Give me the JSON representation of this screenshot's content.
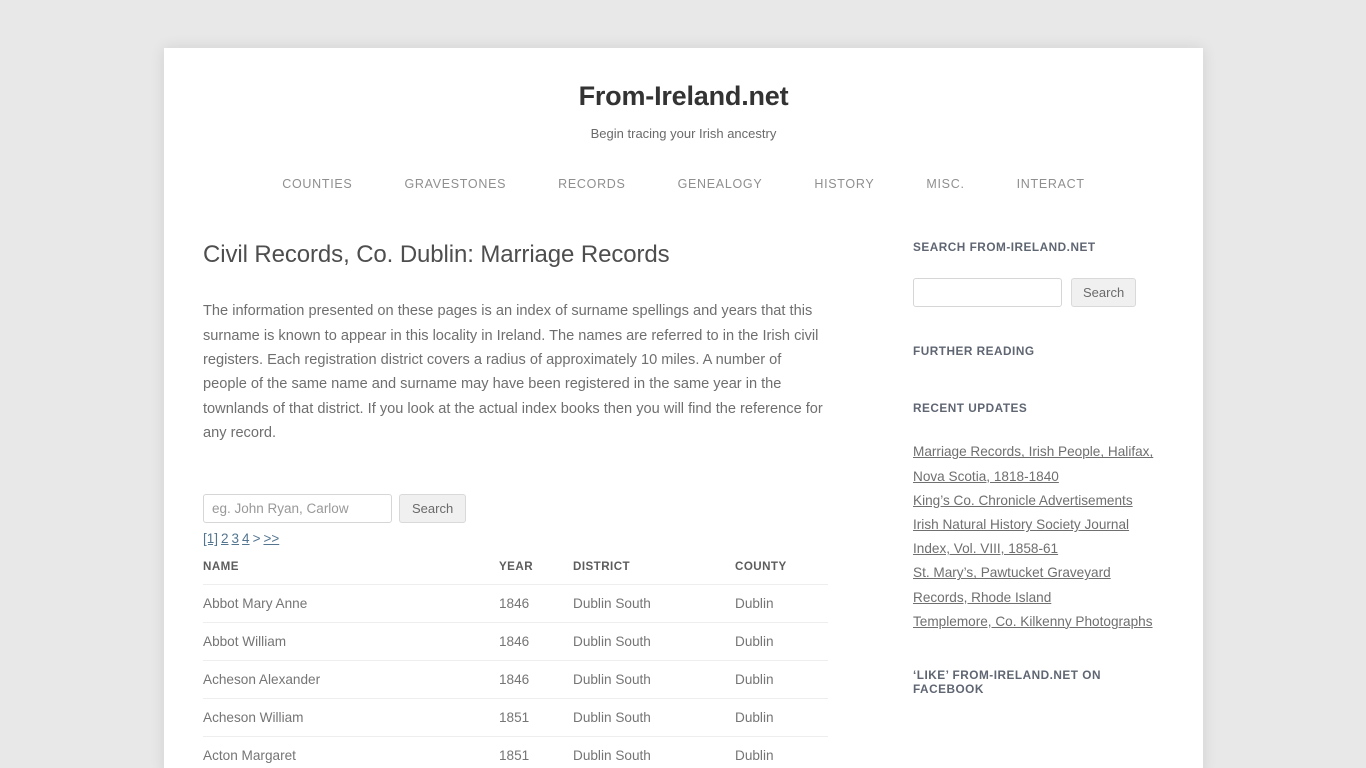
{
  "site": {
    "title": "From-Ireland.net",
    "description": "Begin tracing your Irish ancestry",
    "nav": [
      {
        "label": "COUNTIES"
      },
      {
        "label": "GRAVESTONES"
      },
      {
        "label": "RECORDS"
      },
      {
        "label": "GENEALOGY"
      },
      {
        "label": "HISTORY"
      },
      {
        "label": "MISC."
      },
      {
        "label": "INTERACT"
      }
    ]
  },
  "main": {
    "title": "Civil Records, Co. Dublin: Marriage Records",
    "intro": "The information presented on these pages is an index of surname spellings and years that this surname is known to appear in this locality in Ireland. The names are referred to in the Irish civil registers. Each registration district covers a radius of approximately 10 miles. A number of people of the same name and surname may have been registered in the same year in the townlands of that district. If you look at the actual index books then you will find the reference for any record.",
    "search": {
      "value": "",
      "placeholder": "eg. John Ryan, Carlow",
      "button_label": "Search"
    },
    "pagination": {
      "current": "[1]",
      "pages": [
        "2",
        "3",
        "4"
      ],
      "next": ">",
      "last": ">>"
    },
    "table": {
      "columns": [
        "NAME",
        "YEAR",
        "DISTRICT",
        "COUNTY"
      ],
      "rows": [
        {
          "name": "Abbot Mary Anne",
          "year": "1846",
          "district": "Dublin South",
          "county": "Dublin"
        },
        {
          "name": "Abbot William",
          "year": "1846",
          "district": "Dublin South",
          "county": "Dublin"
        },
        {
          "name": "Acheson Alexander",
          "year": "1846",
          "district": "Dublin South",
          "county": "Dublin"
        },
        {
          "name": "Acheson William",
          "year": "1851",
          "district": "Dublin South",
          "county": "Dublin"
        },
        {
          "name": "Acton Margaret",
          "year": "1851",
          "district": "Dublin South",
          "county": "Dublin"
        }
      ]
    }
  },
  "sidebar": {
    "search_widget": {
      "title": "SEARCH FROM-IRELAND.NET",
      "value": "",
      "placeholder": "",
      "button_label": "Search"
    },
    "further_reading": {
      "title": "FURTHER READING"
    },
    "recent_updates": {
      "title": "RECENT UPDATES",
      "items": [
        {
          "label": "Marriage Records, Irish People, Halifax, Nova Scotia, 1818-1840"
        },
        {
          "label": "King’s Co. Chronicle Advertisements"
        },
        {
          "label": "Irish Natural History Society Journal Index, Vol. VIII, 1858-61"
        },
        {
          "label": "St. Mary’s, Pawtucket Graveyard Records, Rhode Island"
        },
        {
          "label": "Templemore, Co. Kilkenny Photographs"
        }
      ]
    },
    "facebook_widget": {
      "title": "‘LIKE’ FROM-IRELAND.NET ON FACEBOOK"
    }
  },
  "colors": {
    "page_background": "#e8e8e8",
    "container_background": "#ffffff",
    "heading_text": "#4e4e4e",
    "body_text": "#6f6f6f",
    "nav_text": "#8f8f8f",
    "link": "#53758f",
    "widget_title": "#5f6672",
    "table_border": "#eeeeee"
  }
}
